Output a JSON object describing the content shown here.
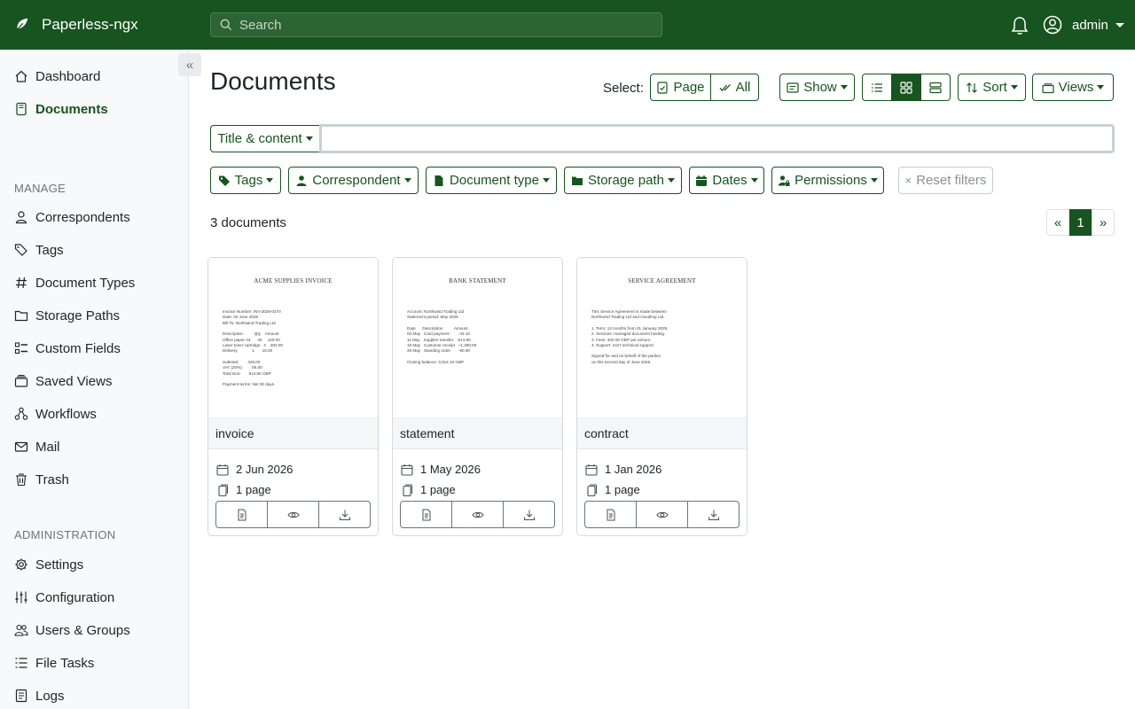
{
  "app": {
    "name": "Paperless-ngx"
  },
  "search": {
    "placeholder": "Search"
  },
  "user": {
    "name": "admin"
  },
  "sidebar": {
    "top_items": [
      {
        "label": "Dashboard",
        "icon": "house-icon"
      },
      {
        "label": "Documents",
        "icon": "document-icon",
        "active": true
      }
    ],
    "manage_heading": "MANAGE",
    "manage_items": [
      {
        "label": "Correspondents",
        "icon": "person-icon"
      },
      {
        "label": "Tags",
        "icon": "tags-icon"
      },
      {
        "label": "Document Types",
        "icon": "hash-icon"
      },
      {
        "label": "Storage Paths",
        "icon": "folder-icon"
      },
      {
        "label": "Custom Fields",
        "icon": "ui-checks-icon"
      },
      {
        "label": "Saved Views",
        "icon": "collection-icon"
      },
      {
        "label": "Workflows",
        "icon": "diagram-icon"
      },
      {
        "label": "Mail",
        "icon": "envelope-icon"
      },
      {
        "label": "Trash",
        "icon": "trash-icon"
      }
    ],
    "admin_heading": "ADMINISTRATION",
    "admin_items": [
      {
        "label": "Settings",
        "icon": "gear-icon"
      },
      {
        "label": "Configuration",
        "icon": "sliders-icon"
      },
      {
        "label": "Users & Groups",
        "icon": "people-icon"
      },
      {
        "label": "File Tasks",
        "icon": "list-task-icon"
      },
      {
        "label": "Logs",
        "icon": "log-icon"
      }
    ]
  },
  "main": {
    "title": "Documents",
    "select_label": "Select:",
    "select_page": "Page",
    "select_all": "All",
    "show": "Show",
    "sort": "Sort",
    "views": "Views",
    "view_mode_active": "small-cards",
    "title_content_filter": "Title & content",
    "filter_value": "",
    "filters": {
      "tags": "Tags",
      "correspondent": "Correspondent",
      "document_type": "Document type",
      "storage_path": "Storage path",
      "dates": "Dates",
      "permissions": "Permissions",
      "reset": "Reset filters"
    },
    "doc_count": "3 documents",
    "pager": {
      "prev": "«",
      "current": "1",
      "next": "»"
    }
  },
  "documents": [
    {
      "title": "invoice",
      "date": "2 Jun 2026",
      "pages": "1 page",
      "thumb_title": "ACME SUPPLIES INVOICE",
      "thumb_lines": [
        "Invoice Number: INV-2026-0470",
        "Date: 02 June 2026",
        "Bill To: Northwind Trading Ltd",
        "",
        "Description          Qty    Amount",
        "Office paper A4      40     120.00",
        "Laser toner cartridge   4    284.00",
        "Delivery             1       15.00",
        "",
        "Subtotal:        429.00",
        "VAT (20%):        85.00",
        "Total Due:       514.80 GBP",
        "",
        "Payment terms: Net 30 days."
      ]
    },
    {
      "title": "statement",
      "date": "1 May 2026",
      "pages": "1 page",
      "thumb_title": "BANK STATEMENT",
      "thumb_lines": [
        "Account: Northwind Trading Ltd",
        "Statement period: May 2026",
        "",
        "Date      Description          Amount",
        "03 May   Card payment        -42.10",
        "11 May   Supplier transfer   -514.80",
        "19 May   Customer receipt   +1,250.00",
        "28 May   Standing order       -90.00",
        "",
        "Closing balance: 3,914.10 GBP"
      ]
    },
    {
      "title": "contract",
      "date": "1 Jan 2026",
      "pages": "1 page",
      "thumb_title": "SERVICE AGREEMENT",
      "thumb_lines": [
        "This Service Agreement is made between",
        "Northwind Trading Ltd and cloudimg Ltd.",
        "",
        "1. Term: 12 months from 01 January 2026.",
        "2. Services: managed document hosting.",
        "3. Fees: 400.00 GBP per annum.",
        "4. Support: 24x7 technical support.",
        "",
        "Signed for and on behalf of the parties",
        "on this second day of June 2026."
      ]
    }
  ],
  "colors": {
    "primary": "#17541f",
    "sidebar_bg": "#f8f9fa"
  }
}
